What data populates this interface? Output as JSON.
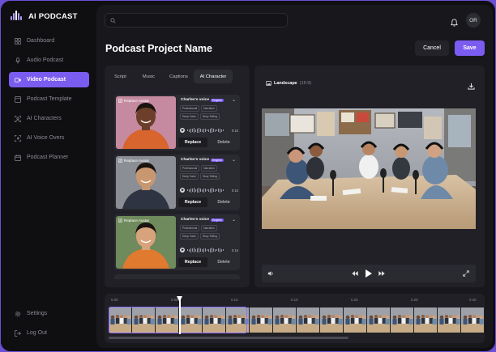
{
  "app": {
    "name": "AI PODCAST"
  },
  "sidebar": {
    "items": [
      {
        "label": "Dashboard",
        "icon": "grid-icon"
      },
      {
        "label": "Audio Podcast",
        "icon": "microphone-icon"
      },
      {
        "label": "Video Podcast",
        "icon": "video-icon",
        "active": true
      },
      {
        "label": "Podcast Template",
        "icon": "template-icon"
      },
      {
        "label": "AI Characters",
        "icon": "character-icon"
      },
      {
        "label": "AI Voice Overs",
        "icon": "voice-icon"
      },
      {
        "label": "Podcast Planner",
        "icon": "calendar-icon"
      }
    ],
    "bottom": [
      {
        "label": "Settings",
        "icon": "gear-icon"
      },
      {
        "label": "Log Out",
        "icon": "logout-icon"
      }
    ]
  },
  "header": {
    "search_placeholder": "",
    "avatar_initials": "OR"
  },
  "page": {
    "title": "Podcast Project Name",
    "cancel_label": "Cancel",
    "save_label": "Save"
  },
  "editor": {
    "tabs": [
      "Script",
      "Music",
      "Captions",
      "AI Character"
    ],
    "active_tab": "AI Character",
    "cards": [
      {
        "replace_avatar": "Replace Avatar",
        "voice": "Charles's voice",
        "lang": "English",
        "tags": [
          "Professional",
          "Narration",
          "Deep Voice",
          "Story Telling"
        ],
        "duration": "0:15",
        "replace": "Replace",
        "delete": "Delete",
        "skin": "#6b3f2a",
        "shirt": "#d8642e",
        "bg": "#c58a9f"
      },
      {
        "replace_avatar": "Replace Avatar",
        "voice": "Charles's voice",
        "lang": "English",
        "tags": [
          "Professional",
          "Narration",
          "Deep Voice",
          "Story Telling"
        ],
        "duration": "0:15",
        "replace": "Replace",
        "delete": "Delete",
        "skin": "#c9976f",
        "shirt": "#2f3442",
        "bg": "#8b8f95"
      },
      {
        "replace_avatar": "Replace Avatar",
        "voice": "Charles's voice",
        "lang": "English",
        "tags": [
          "Professional",
          "Narration",
          "Deep Voice",
          "Story Telling"
        ],
        "duration": "0:15",
        "replace": "Replace",
        "delete": "Delete",
        "skin": "#d8a27d",
        "shirt": "#e07a2f",
        "bg": "#6f8a5c"
      }
    ]
  },
  "preview": {
    "format": "Landscape",
    "ratio": "(16:9)"
  },
  "timeline": {
    "ticks": [
      "0.00",
      "0.05",
      "0.10",
      "0.15",
      "0.20",
      "0.25",
      "0.30"
    ]
  }
}
